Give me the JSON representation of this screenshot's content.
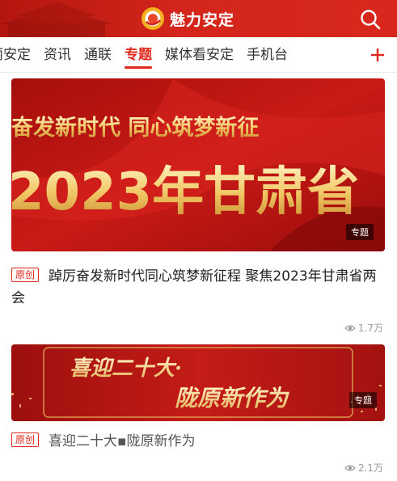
{
  "header": {
    "brand_name": "魅力安定",
    "colors": {
      "bar": "#d3251b",
      "accent": "#e0281d"
    },
    "icons": {
      "logo": "brand-logo-icon",
      "search": "search-icon"
    }
  },
  "tabs": {
    "items": [
      {
        "label": "美丽安定",
        "active": false
      },
      {
        "label": "资讯",
        "active": false
      },
      {
        "label": "通联",
        "active": false
      },
      {
        "label": "专题",
        "active": true
      },
      {
        "label": "媒体看安定",
        "active": false
      },
      {
        "label": "手机台",
        "active": false
      }
    ],
    "add_icon": "plus-icon"
  },
  "feed": [
    {
      "banner": {
        "line1": "奋发新时代   同心筑梦新征",
        "line2": "2023年甘肃省"
      },
      "badge": "专题",
      "tag": "原创",
      "title": "踔厉奋发新时代同心筑梦新征程  聚焦2023年甘肃省两会",
      "views": "1.7万",
      "views_icon": "eye-icon"
    },
    {
      "banner": {
        "line1": "喜迎二十大·",
        "line2": "陇原新作为"
      },
      "badge": "专题",
      "tag": "原创",
      "title": "喜迎二十大▪陇原新作为",
      "views": "2.1万",
      "views_icon": "eye-icon"
    }
  ]
}
